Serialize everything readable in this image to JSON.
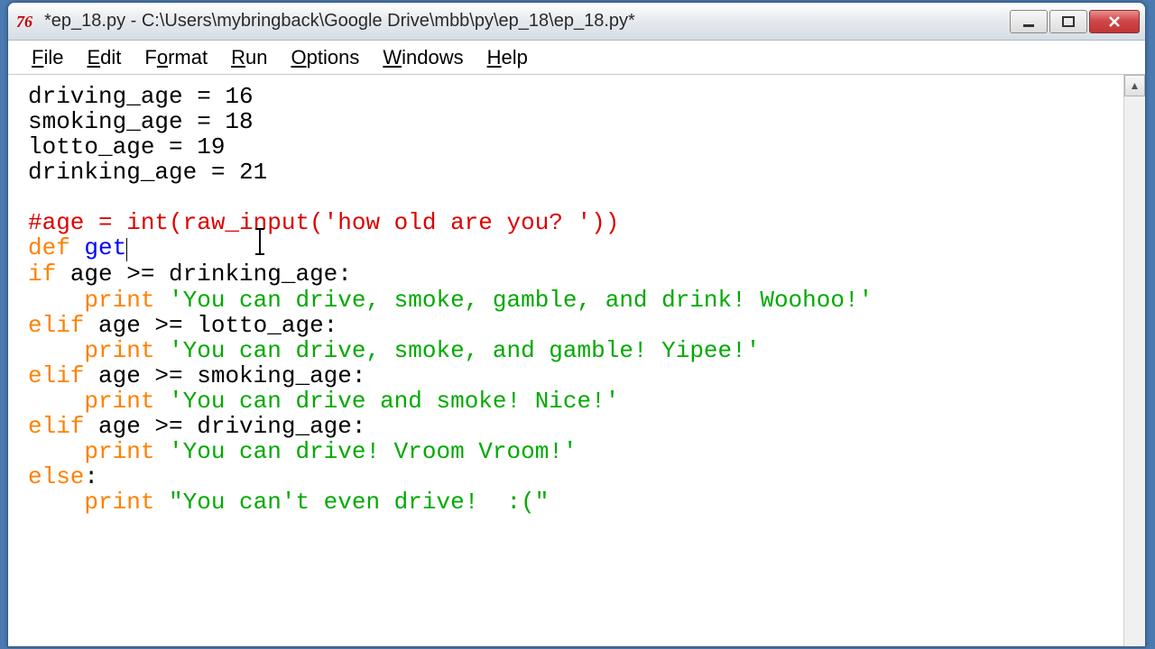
{
  "window": {
    "title": "*ep_18.py - C:\\Users\\mybringback\\Google Drive\\mbb\\py\\ep_18\\ep_18.py*"
  },
  "menu": {
    "file": "File",
    "edit": "Edit",
    "format": "Format",
    "run": "Run",
    "options": "Options",
    "windows": "Windows",
    "help": "Help"
  },
  "code": {
    "l1_a": "driving_age = 16",
    "l2_a": "smoking_age = 18",
    "l3_a": "lotto_age = 19",
    "l4_a": "drinking_age = 21",
    "l5_blank": "",
    "l6_com": "#age = int(raw_input('how old are you? '))",
    "l7_def": "def",
    "l7_name": " get",
    "l8_kw": "if",
    "l8_rest": " age >= drinking_age:",
    "l9_kw": "    print",
    "l9_str": " 'You can drive, smoke, gamble, and drink! Woohoo!'",
    "l10_kw": "elif",
    "l10_rest": " age >= lotto_age:",
    "l11_kw": "    print",
    "l11_str": " 'You can drive, smoke, and gamble! Yipee!'",
    "l12_kw": "elif",
    "l12_rest": " age >= smoking_age:",
    "l13_kw": "    print",
    "l13_str": " 'You can drive and smoke! Nice!'",
    "l14_kw": "elif",
    "l14_rest": " age >= driving_age:",
    "l15_kw": "    print",
    "l15_str": " 'You can drive! Vroom Vroom!'",
    "l16_kw": "else",
    "l16_rest": ":",
    "l17_kw": "    print",
    "l17_str": " \"You can't even drive!  :(\""
  }
}
